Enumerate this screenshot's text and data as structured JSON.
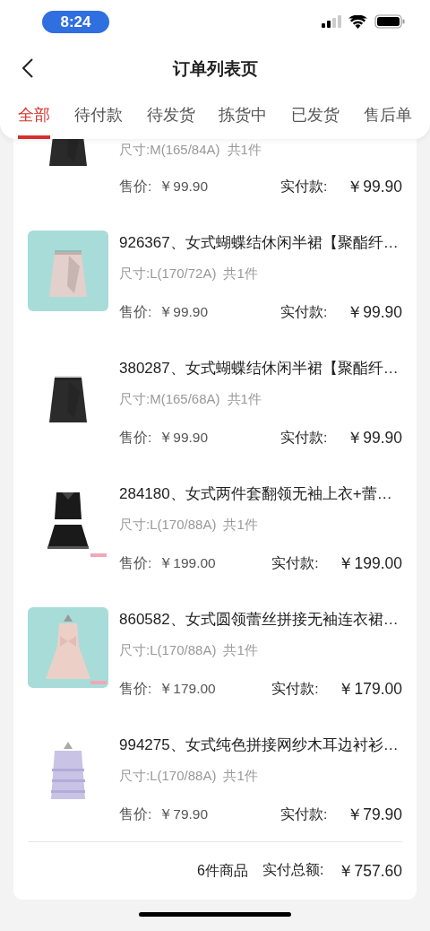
{
  "status_bar": {
    "time": "8:24"
  },
  "header": {
    "title": "订单列表页"
  },
  "tabs": [
    {
      "label": "全部",
      "selected": true
    },
    {
      "label": "待付款",
      "selected": false
    },
    {
      "label": "待发货",
      "selected": false
    },
    {
      "label": "拣货中",
      "selected": false
    },
    {
      "label": "已发货",
      "selected": false
    },
    {
      "label": "售后单",
      "selected": false
    }
  ],
  "order": {
    "items": [
      {
        "size": "尺寸:M(165/84A)",
        "count": "共1件",
        "price_label": "售价:",
        "price": "￥99.90",
        "paid_label": "实付款:",
        "paid": "￥99.90"
      },
      {
        "title": "926367、女式蝴蝶结休闲半裙【聚酯纤…",
        "size": "尺寸:L(170/72A)",
        "count": "共1件",
        "price_label": "售价:",
        "price": "￥99.90",
        "paid_label": "实付款:",
        "paid": "￥99.90"
      },
      {
        "title": "380287、女式蝴蝶结休闲半裙【聚酯纤…",
        "size": "尺寸:M(165/68A)",
        "count": "共1件",
        "price_label": "售价:",
        "price": "￥99.90",
        "paid_label": "实付款:",
        "paid": "￥99.90"
      },
      {
        "title": "284180、女式两件套翻领无袖上衣+蕾…",
        "size": "尺寸:L(170/88A)",
        "count": "共1件",
        "price_label": "售价:",
        "price": "￥199.00",
        "paid_label": "实付款:",
        "paid": "￥199.00"
      },
      {
        "title": "860582、女式圆领蕾丝拼接无袖连衣裙…",
        "size": "尺寸:L(170/88A)",
        "count": "共1件",
        "price_label": "售价:",
        "price": "￥179.00",
        "paid_label": "实付款:",
        "paid": "￥179.00"
      },
      {
        "title": "994275、女式纯色拼接网纱木耳边衬衫…",
        "size": "尺寸:L(170/88A)",
        "count": "共1件",
        "price_label": "售价:",
        "price": "￥79.90",
        "paid_label": "实付款:",
        "paid": "￥79.90"
      }
    ],
    "summary": {
      "count": "6件商品",
      "total_label": "实付总额:",
      "total": "￥757.60"
    }
  }
}
